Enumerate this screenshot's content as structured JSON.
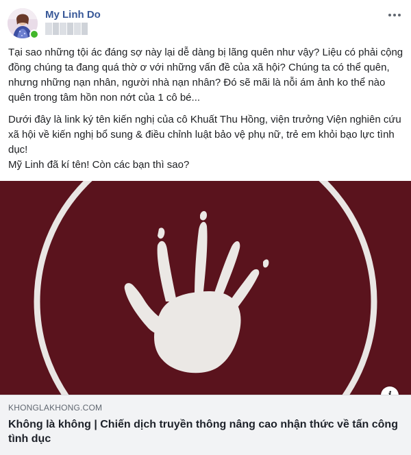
{
  "post": {
    "author_name": "My Linh Do",
    "paragraphs": [
      "Tại sao những tội ác đáng sợ này lại dễ dàng bị lãng quên như vậy? Liệu có phải cộng đồng chúng ta đang quá thờ ơ với những vấn đề của xã hội? Chúng ta có thể quên, nhưng những nạn nhân, người nhà nạn nhân? Đó sẽ mãi là nỗi ám ảnh ko thể nào quên trong tâm hồn non nớt của 1 cô bé...",
      "Dưới đây là link ký tên kiến nghị của cô Khuất Thu Hồng, viện trưởng Viện nghiên cứu xã hội về kiến nghị bổ sung & điều chỉnh luật bảo vệ phụ nữ, trẻ em khỏi bạo lực tình dục!\nMỹ Linh đã kí tên! Còn các bạn thì sao?"
    ]
  },
  "link_preview": {
    "domain": "KHONGLAKHONG.COM",
    "title": "Không là không | Chiến dịch truyền thông nâng cao nhận thức về tấn công tình dục",
    "info_label": "i"
  },
  "colors": {
    "author_link": "#385898",
    "preview_background": "#5a131d",
    "online_indicator": "#42b72a"
  },
  "icons": {
    "more": "more-options-icon",
    "info": "info-icon",
    "hand": "handprint-icon"
  }
}
